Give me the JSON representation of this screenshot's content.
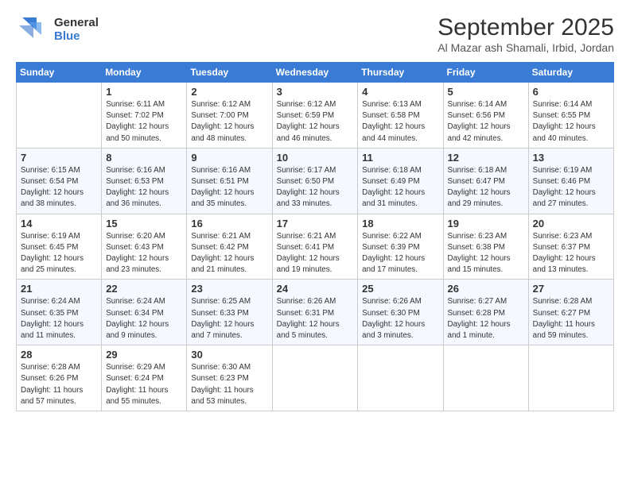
{
  "header": {
    "logo_general": "General",
    "logo_blue": "Blue",
    "month_title": "September 2025",
    "location": "Al Mazar ash Shamali, Irbid, Jordan"
  },
  "days_of_week": [
    "Sunday",
    "Monday",
    "Tuesday",
    "Wednesday",
    "Thursday",
    "Friday",
    "Saturday"
  ],
  "weeks": [
    [
      {
        "day": "",
        "info": ""
      },
      {
        "day": "1",
        "info": "Sunrise: 6:11 AM\nSunset: 7:02 PM\nDaylight: 12 hours\nand 50 minutes."
      },
      {
        "day": "2",
        "info": "Sunrise: 6:12 AM\nSunset: 7:00 PM\nDaylight: 12 hours\nand 48 minutes."
      },
      {
        "day": "3",
        "info": "Sunrise: 6:12 AM\nSunset: 6:59 PM\nDaylight: 12 hours\nand 46 minutes."
      },
      {
        "day": "4",
        "info": "Sunrise: 6:13 AM\nSunset: 6:58 PM\nDaylight: 12 hours\nand 44 minutes."
      },
      {
        "day": "5",
        "info": "Sunrise: 6:14 AM\nSunset: 6:56 PM\nDaylight: 12 hours\nand 42 minutes."
      },
      {
        "day": "6",
        "info": "Sunrise: 6:14 AM\nSunset: 6:55 PM\nDaylight: 12 hours\nand 40 minutes."
      }
    ],
    [
      {
        "day": "7",
        "info": "Sunrise: 6:15 AM\nSunset: 6:54 PM\nDaylight: 12 hours\nand 38 minutes."
      },
      {
        "day": "8",
        "info": "Sunrise: 6:16 AM\nSunset: 6:53 PM\nDaylight: 12 hours\nand 36 minutes."
      },
      {
        "day": "9",
        "info": "Sunrise: 6:16 AM\nSunset: 6:51 PM\nDaylight: 12 hours\nand 35 minutes."
      },
      {
        "day": "10",
        "info": "Sunrise: 6:17 AM\nSunset: 6:50 PM\nDaylight: 12 hours\nand 33 minutes."
      },
      {
        "day": "11",
        "info": "Sunrise: 6:18 AM\nSunset: 6:49 PM\nDaylight: 12 hours\nand 31 minutes."
      },
      {
        "day": "12",
        "info": "Sunrise: 6:18 AM\nSunset: 6:47 PM\nDaylight: 12 hours\nand 29 minutes."
      },
      {
        "day": "13",
        "info": "Sunrise: 6:19 AM\nSunset: 6:46 PM\nDaylight: 12 hours\nand 27 minutes."
      }
    ],
    [
      {
        "day": "14",
        "info": "Sunrise: 6:19 AM\nSunset: 6:45 PM\nDaylight: 12 hours\nand 25 minutes."
      },
      {
        "day": "15",
        "info": "Sunrise: 6:20 AM\nSunset: 6:43 PM\nDaylight: 12 hours\nand 23 minutes."
      },
      {
        "day": "16",
        "info": "Sunrise: 6:21 AM\nSunset: 6:42 PM\nDaylight: 12 hours\nand 21 minutes."
      },
      {
        "day": "17",
        "info": "Sunrise: 6:21 AM\nSunset: 6:41 PM\nDaylight: 12 hours\nand 19 minutes."
      },
      {
        "day": "18",
        "info": "Sunrise: 6:22 AM\nSunset: 6:39 PM\nDaylight: 12 hours\nand 17 minutes."
      },
      {
        "day": "19",
        "info": "Sunrise: 6:23 AM\nSunset: 6:38 PM\nDaylight: 12 hours\nand 15 minutes."
      },
      {
        "day": "20",
        "info": "Sunrise: 6:23 AM\nSunset: 6:37 PM\nDaylight: 12 hours\nand 13 minutes."
      }
    ],
    [
      {
        "day": "21",
        "info": "Sunrise: 6:24 AM\nSunset: 6:35 PM\nDaylight: 12 hours\nand 11 minutes."
      },
      {
        "day": "22",
        "info": "Sunrise: 6:24 AM\nSunset: 6:34 PM\nDaylight: 12 hours\nand 9 minutes."
      },
      {
        "day": "23",
        "info": "Sunrise: 6:25 AM\nSunset: 6:33 PM\nDaylight: 12 hours\nand 7 minutes."
      },
      {
        "day": "24",
        "info": "Sunrise: 6:26 AM\nSunset: 6:31 PM\nDaylight: 12 hours\nand 5 minutes."
      },
      {
        "day": "25",
        "info": "Sunrise: 6:26 AM\nSunset: 6:30 PM\nDaylight: 12 hours\nand 3 minutes."
      },
      {
        "day": "26",
        "info": "Sunrise: 6:27 AM\nSunset: 6:28 PM\nDaylight: 12 hours\nand 1 minute."
      },
      {
        "day": "27",
        "info": "Sunrise: 6:28 AM\nSunset: 6:27 PM\nDaylight: 11 hours\nand 59 minutes."
      }
    ],
    [
      {
        "day": "28",
        "info": "Sunrise: 6:28 AM\nSunset: 6:26 PM\nDaylight: 11 hours\nand 57 minutes."
      },
      {
        "day": "29",
        "info": "Sunrise: 6:29 AM\nSunset: 6:24 PM\nDaylight: 11 hours\nand 55 minutes."
      },
      {
        "day": "30",
        "info": "Sunrise: 6:30 AM\nSunset: 6:23 PM\nDaylight: 11 hours\nand 53 minutes."
      },
      {
        "day": "",
        "info": ""
      },
      {
        "day": "",
        "info": ""
      },
      {
        "day": "",
        "info": ""
      },
      {
        "day": "",
        "info": ""
      }
    ]
  ]
}
